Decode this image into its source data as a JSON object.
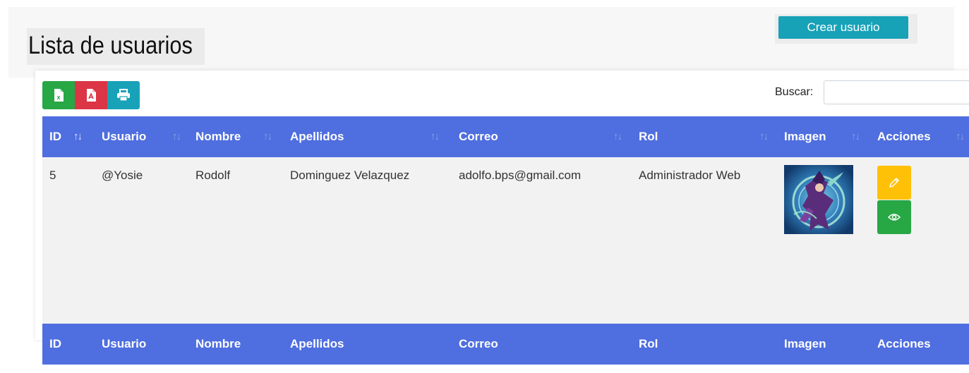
{
  "header": {
    "title": "Lista de usuarios",
    "create_button": "Crear usuario"
  },
  "toolbar": {
    "export_excel_icon": "file-excel-icon",
    "export_pdf_icon": "file-pdf-icon",
    "print_icon": "print-icon",
    "search_label": "Buscar:",
    "search_value": ""
  },
  "table": {
    "columns": [
      "ID",
      "Usuario",
      "Nombre",
      "Apellidos",
      "Correo",
      "Rol",
      "Imagen",
      "Acciones"
    ],
    "rows": [
      {
        "id": "5",
        "usuario": "@Yosie",
        "nombre": "Rodolf",
        "apellidos": "Dominguez Velazquez",
        "correo": "adolfo.bps@gmail.com",
        "rol": "Administrador Web",
        "imagen": "user-avatar-image",
        "actions": [
          "edit-icon",
          "eye-icon"
        ]
      }
    ]
  },
  "colors": {
    "header_bg": "#4f6edf",
    "create_button": "#17a2b8",
    "excel": "#28a745",
    "pdf": "#dc3545",
    "print": "#17a2b8",
    "edit": "#ffc107",
    "view": "#28a745",
    "row_bg": "#f2f2f2"
  }
}
